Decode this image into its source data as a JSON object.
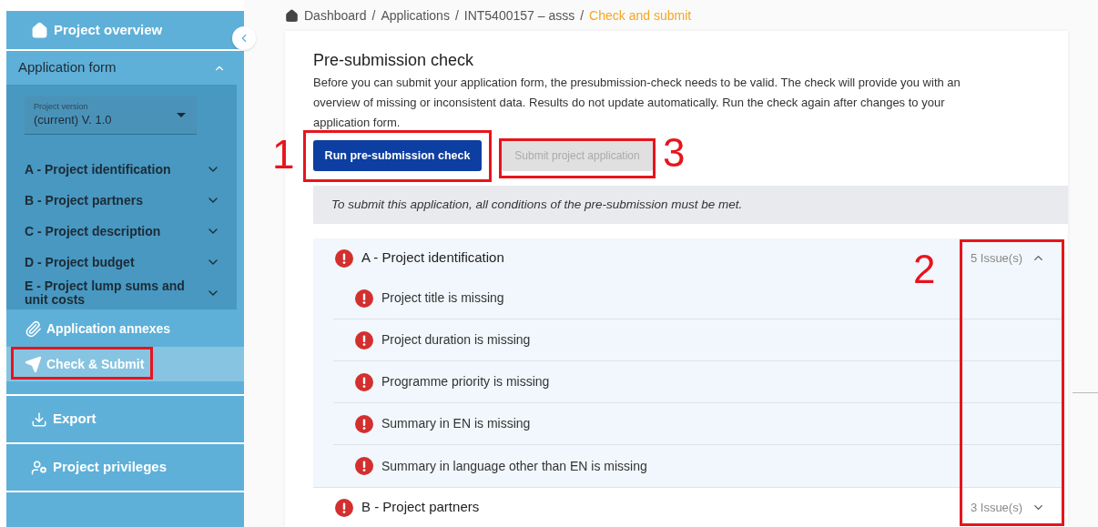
{
  "sidebar": {
    "overview": {
      "label": "Project overview"
    },
    "application_form": {
      "label": "Application form",
      "expanded": true,
      "version": {
        "label": "Project version",
        "value": "(current) V. 1.0"
      },
      "sections": [
        {
          "label": "A - Project identification",
          "expanded": false
        },
        {
          "label": "B - Project partners",
          "expanded": false
        },
        {
          "label": "C - Project description",
          "expanded": false
        },
        {
          "label": "D - Project budget",
          "expanded": false
        },
        {
          "label": "E - Project lump sums and unit costs",
          "expanded": false
        }
      ]
    },
    "items": [
      {
        "kind": "annexes",
        "label": "Application annexes",
        "selected": false
      },
      {
        "kind": "submit",
        "label": "Check & Submit",
        "selected": true
      }
    ],
    "bottom_items": [
      {
        "kind": "export",
        "label": "Export"
      },
      {
        "kind": "privileges",
        "label": "Project privileges"
      }
    ]
  },
  "breadcrumb": [
    {
      "kind": "link",
      "label": "Dashboard",
      "current": false
    },
    {
      "kind": "separator",
      "label": "/"
    },
    {
      "kind": "link",
      "label": "Applications",
      "current": false
    },
    {
      "kind": "separator",
      "label": "/"
    },
    {
      "kind": "link",
      "label": "INT5400157 – asss",
      "current": false
    },
    {
      "kind": "separator",
      "label": "/"
    },
    {
      "kind": "link",
      "label": "Check and submit",
      "current": true
    }
  ],
  "check": {
    "title": "Pre-submission check",
    "description": "Before you can submit your application form, the presubmission-check needs to be valid. The check will provide you with an overview of missing or inconsistent data. Results do not update automatically. Run the check again after changes to your application form.",
    "buttons": [
      {
        "label": "Run pre-submission check",
        "disabled": false
      },
      {
        "label": "Submit project application",
        "disabled": true
      }
    ],
    "notice": "To submit this application, all conditions of the pre-submission must be met.",
    "sections": [
      {
        "title": "A - Project identification",
        "issues": "5 Issue(s)",
        "expanded": true,
        "items": [
          "Project title is missing",
          "Project duration is missing",
          "Programme priority is missing",
          "Summary in EN is missing",
          "Summary in language other than EN is missing"
        ]
      },
      {
        "title": "B - Project partners",
        "issues": "3 Issue(s)",
        "expanded": false
      }
    ]
  },
  "annotations": [
    "1",
    "2",
    "3"
  ]
}
